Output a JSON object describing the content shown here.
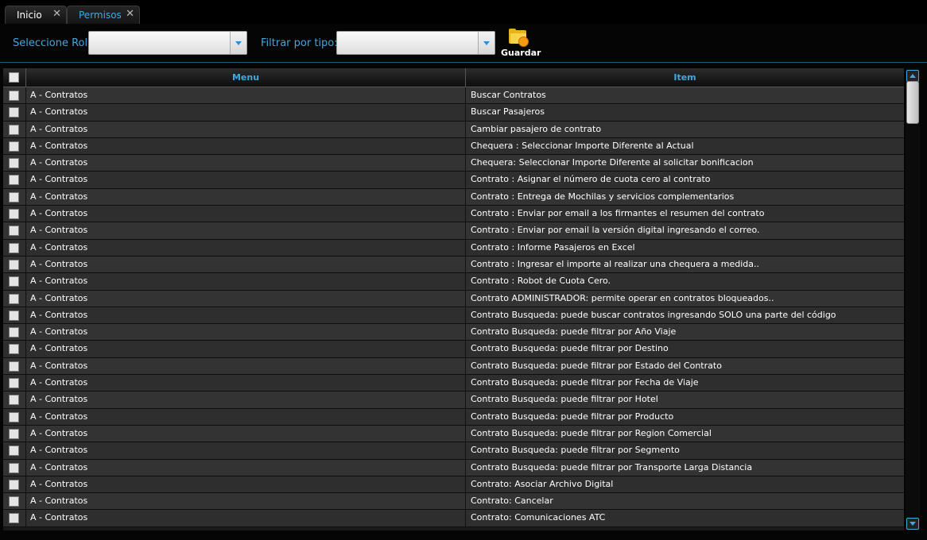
{
  "tabs": [
    {
      "label": "Inicio",
      "close": "✕"
    },
    {
      "label": "Permisos",
      "close": "✕"
    }
  ],
  "toolbar": {
    "role_label": "Seleccione Rol:",
    "role_value": "",
    "type_label": "Filtrar por tipo:",
    "type_value": "",
    "save_label": "Guardar",
    "save_icon": "folder-save-icon"
  },
  "grid": {
    "columns": [
      "Menu",
      "Item"
    ],
    "rows": [
      {
        "menu": "A - Contratos",
        "item": "Buscar Contratos"
      },
      {
        "menu": "A - Contratos",
        "item": "Buscar Pasajeros"
      },
      {
        "menu": "A - Contratos",
        "item": "Cambiar pasajero de contrato"
      },
      {
        "menu": "A - Contratos",
        "item": "Chequera : Seleccionar Importe Diferente al Actual"
      },
      {
        "menu": "A - Contratos",
        "item": "Chequera: Seleccionar Importe Diferente al solicitar bonificacion"
      },
      {
        "menu": "A - Contratos",
        "item": "Contrato : Asignar el número de cuota cero al contrato"
      },
      {
        "menu": "A - Contratos",
        "item": "Contrato : Entrega de Mochilas y servicios complementarios"
      },
      {
        "menu": "A - Contratos",
        "item": "Contrato : Enviar por email a los firmantes el resumen del contrato"
      },
      {
        "menu": "A - Contratos",
        "item": "Contrato : Enviar por email la versión digital ingresando el correo."
      },
      {
        "menu": "A - Contratos",
        "item": "Contrato : Informe Pasajeros en Excel"
      },
      {
        "menu": "A - Contratos",
        "item": "Contrato : Ingresar el importe al realizar una chequera a medida.."
      },
      {
        "menu": "A - Contratos",
        "item": "Contrato : Robot de Cuota Cero."
      },
      {
        "menu": "A - Contratos",
        "item": "Contrato ADMINISTRADOR: permite operar en contratos bloqueados.."
      },
      {
        "menu": "A - Contratos",
        "item": "Contrato Busqueda: puede buscar contratos ingresando SOLO una parte del código"
      },
      {
        "menu": "A - Contratos",
        "item": "Contrato Busqueda: puede filtrar por Año Viaje"
      },
      {
        "menu": "A - Contratos",
        "item": "Contrato Busqueda: puede filtrar por Destino"
      },
      {
        "menu": "A - Contratos",
        "item": "Contrato Busqueda: puede filtrar por Estado del Contrato"
      },
      {
        "menu": "A - Contratos",
        "item": "Contrato Busqueda: puede filtrar por Fecha de Viaje"
      },
      {
        "menu": "A - Contratos",
        "item": "Contrato Busqueda: puede filtrar por Hotel"
      },
      {
        "menu": "A - Contratos",
        "item": "Contrato Busqueda: puede filtrar por Producto"
      },
      {
        "menu": "A - Contratos",
        "item": "Contrato Busqueda: puede filtrar por Region Comercial"
      },
      {
        "menu": "A - Contratos",
        "item": "Contrato Busqueda: puede filtrar por Segmento"
      },
      {
        "menu": "A - Contratos",
        "item": "Contrato Busqueda: puede filtrar por Transporte Larga Distancia"
      },
      {
        "menu": "A - Contratos",
        "item": "Contrato: Asociar Archivo Digital"
      },
      {
        "menu": "A - Contratos",
        "item": "Contrato: Cancelar"
      },
      {
        "menu": "A - Contratos",
        "item": "Contrato: Comunicaciones ATC"
      }
    ]
  }
}
